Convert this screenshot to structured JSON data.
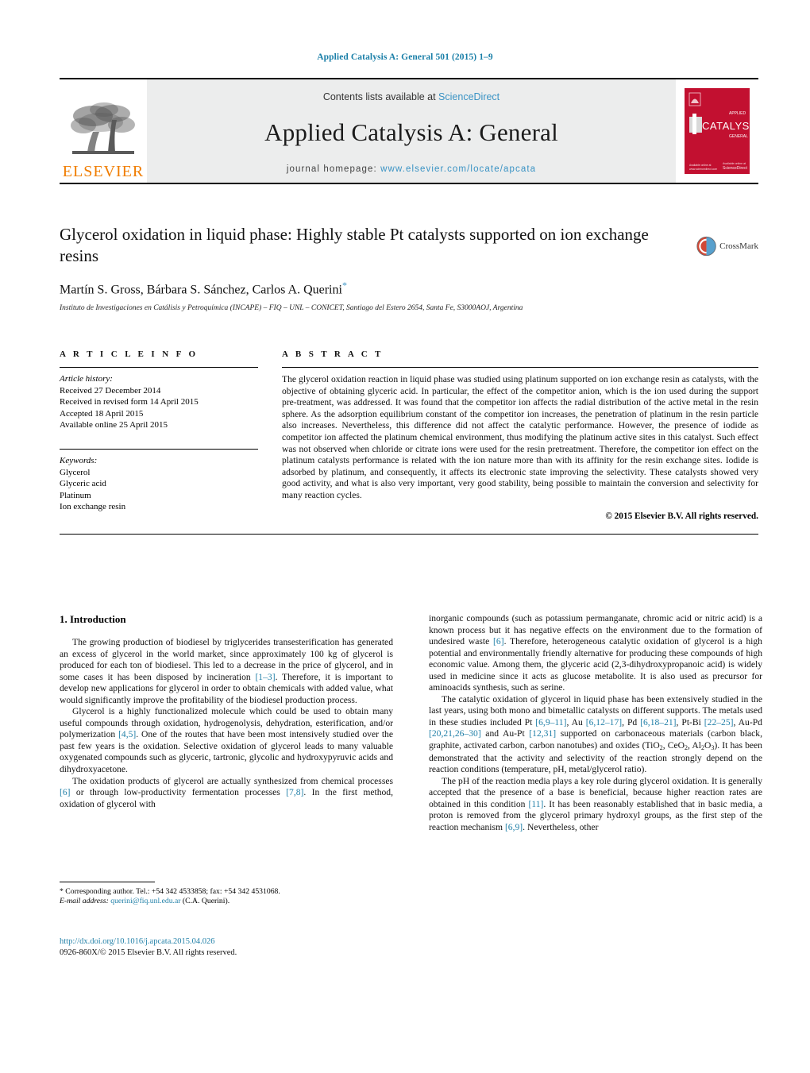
{
  "running_head": "Applied Catalysis A: General 501 (2015) 1–9",
  "masthead": {
    "publisher_name": "ELSEVIER",
    "contents_prefix": "Contents lists available at ",
    "contents_link": "ScienceDirect",
    "journal_title": "Applied Catalysis A: General",
    "homepage_prefix": "journal homepage: ",
    "homepage_url": "www.elsevier.com/locate/apcata",
    "cover_title": "CATALYSIS",
    "cover_sub": "GENERAL",
    "cover_topline": "APPLIED"
  },
  "article": {
    "title": "Glycerol oxidation in liquid phase: Highly stable Pt catalysts supported on ion exchange resins",
    "authors": "Martín S. Gross, Bárbara S. Sánchez, Carlos A. Querini",
    "corresponding_mark": "*",
    "affiliation": "Instituto de Investigaciones en Catálisis y Petroquímica (INCAPE) – FIQ – UNL – CONICET, Santiago del Estero 2654, Santa Fe, S3000AOJ, Argentina",
    "crossmark_label": "CrossMark"
  },
  "article_info": {
    "heading": "A R T I C L E   I N F O",
    "history_label": "Article history:",
    "history": [
      "Received 27 December 2014",
      "Received in revised form 14 April 2015",
      "Accepted 18 April 2015",
      "Available online 25 April 2015"
    ],
    "keywords_label": "Keywords:",
    "keywords": [
      "Glycerol",
      "Glyceric acid",
      "Platinum",
      "Ion exchange resin"
    ]
  },
  "abstract": {
    "heading": "A B S T R A C T",
    "text": "The glycerol oxidation reaction in liquid phase was studied using platinum supported on ion exchange resin as catalysts, with the objective of obtaining glyceric acid. In particular, the effect of the competitor anion, which is the ion used during the support pre-treatment, was addressed. It was found that the competitor ion affects the radial distribution of the active metal in the resin sphere. As the adsorption equilibrium constant of the competitor ion increases, the penetration of platinum in the resin particle also increases. Nevertheless, this difference did not affect the catalytic performance. However, the presence of iodide as competitor ion affected the platinum chemical environment, thus modifying the platinum active sites in this catalyst. Such effect was not observed when chloride or citrate ions were used for the resin pretreatment. Therefore, the competitor ion effect on the platinum catalysts performance is related with the ion nature more than with its affinity for the resin exchange sites. Iodide is adsorbed by platinum, and consequently, it affects its electronic state improving the selectivity. These catalysts showed very good activity, and what is also very important, very good stability, being possible to maintain the conversion and selectivity for many reaction cycles.",
    "copyright": "© 2015 Elsevier B.V. All rights reserved."
  },
  "introduction": {
    "heading": "1.  Introduction",
    "left_paragraphs": [
      "The growing production of biodiesel by triglycerides transesterification has generated an excess of glycerol in the world market, since approximately 100 kg of glycerol is produced for each ton of biodiesel. This led to a decrease in the price of glycerol, and in some cases it has been disposed by incineration [1–3]. Therefore, it is important to develop new applications for glycerol in order to obtain chemicals with added value, what would significantly improve the profitability of the biodiesel production process.",
      "Glycerol is a highly functionalized molecule which could be used to obtain many useful compounds through oxidation, hydrogenolysis, dehydration, esterification, and/or polymerization [4,5]. One of the routes that have been most intensively studied over the past few years is the oxidation. Selective oxidation of glycerol leads to many valuable oxygenated compounds such as glyceric, tartronic, glycolic and hydroxypyruvic acids and dihydroxyacetone.",
      "The oxidation products of glycerol are actually synthesized from chemical processes [6] or through low-productivity fermentation processes [7,8]. In the first method, oxidation of glycerol with"
    ],
    "right_paragraphs": [
      "inorganic compounds (such as potassium permanganate, chromic acid or nitric acid) is a known process but it has negative effects on the environment due to the formation of undesired waste [6]. Therefore, heterogeneous catalytic oxidation of glycerol is a high potential and environmentally friendly alternative for producing these compounds of high economic value. Among them, the glyceric acid (2,3-dihydroxypropanoic acid) is widely used in medicine since it acts as glucose metabolite. It is also used as precursor for aminoacids synthesis, such as serine.",
      "The catalytic oxidation of glycerol in liquid phase has been extensively studied in the last years, using both mono and bimetallic catalysts on different supports. The metals used in these studies included Pt [6,9–11], Au [6,12–17], Pd [6,18–21], Pt-Bi [22–25], Au-Pd [20,21,26–30] and Au-Pt [12,31] supported on carbonaceous materials (carbon black, graphite, activated carbon, carbon nanotubes) and oxides (TiO2, CeO2, Al2O3). It has been demonstrated that the activity and selectivity of the reaction strongly depend on the reaction conditions (temperature, pH, metal/glycerol ratio).",
      "The pH of the reaction media plays a key role during glycerol oxidation. It is generally accepted that the presence of a base is beneficial, because higher reaction rates are obtained in this condition [11]. It has been reasonably established that in basic media, a proton is removed from the glycerol primary hydroxyl groups, as the first step of the reaction mechanism [6,9]. Nevertheless, other"
    ]
  },
  "footnote": {
    "corresponding": "*  Corresponding author. Tel.: +54 342 4533858; fax: +54 342 4531068.",
    "email_label": "E-mail address:",
    "email": "querini@fiq.unl.edu.ar",
    "email_suffix": " (C.A. Querini)."
  },
  "footer": {
    "doi": "http://dx.doi.org/10.1016/j.apcata.2015.04.026",
    "issn": "0926-860X/© 2015 Elsevier B.V. All rights reserved."
  },
  "colors": {
    "link": "#2280a8",
    "elsevier_orange": "#f07d00",
    "band_gray": "#eceded",
    "cover_red": "#c21030"
  }
}
